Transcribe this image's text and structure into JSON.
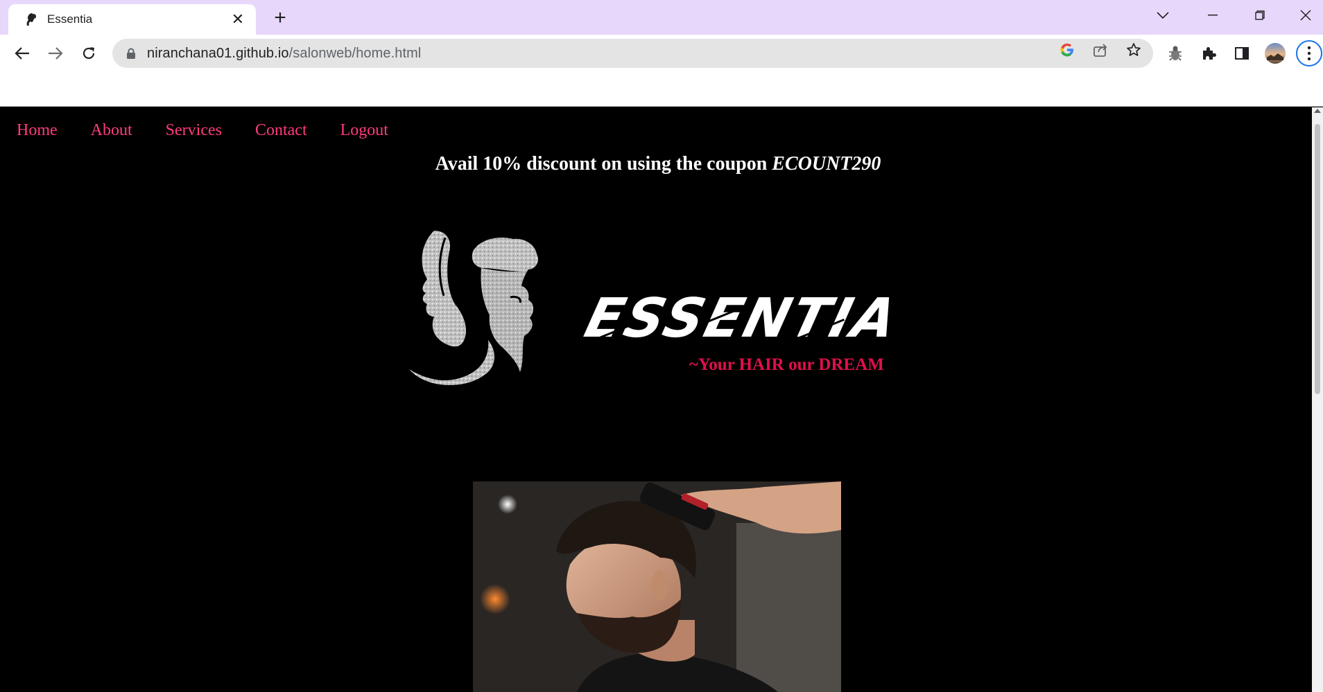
{
  "browser": {
    "tab_title": "Essentia",
    "tab_close": "✕",
    "new_tab": "+",
    "url_host": "niranchana01.github.io",
    "url_path": "/salonweb/home.html"
  },
  "nav": {
    "items": [
      {
        "label": "Home"
      },
      {
        "label": "About"
      },
      {
        "label": "Services"
      },
      {
        "label": "Contact"
      },
      {
        "label": "Logout"
      }
    ],
    "color": "#ff3b7f"
  },
  "promo": {
    "text": "Avail 10% discount on using the coupon ",
    "coupon": "ECOUNT290"
  },
  "brand": {
    "name": "ESSENTIA",
    "tagline": "~Your HAIR our DREAM",
    "tagline_color": "#e0104a"
  },
  "hero": {
    "alt": "Barber trimming a bearded man's hair with clippers"
  }
}
